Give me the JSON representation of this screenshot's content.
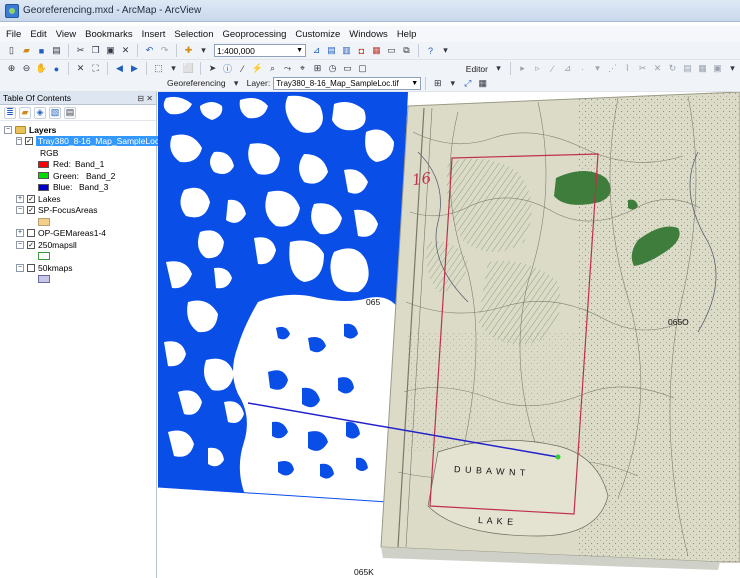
{
  "window": {
    "title": "Georeferencing.mxd - ArcMap - ArcView"
  },
  "menu": [
    "File",
    "Edit",
    "View",
    "Bookmarks",
    "Insert",
    "Selection",
    "Geoprocessing",
    "Customize",
    "Windows",
    "Help"
  ],
  "toolbar": {
    "scale_value": "1:400,000",
    "editor_label": "Editor",
    "georef_label": "Georeferencing",
    "layer_label": "Layer:",
    "layer_value": "Tray380_8-16_Map_SampleLoc.tif"
  },
  "toc": {
    "title": "Table Of Contents",
    "root_label": "Layers",
    "layers": [
      {
        "name": "Tray380_8-16_Map_SampleLoc.tif",
        "checked": true,
        "expanded": true
      },
      {
        "name": "Lakes",
        "checked": true,
        "expanded": false
      },
      {
        "name": "SP-FocusAreas",
        "checked": true,
        "expanded": true
      },
      {
        "name": "OP-GEMareas1-4",
        "checked": false,
        "expanded": false
      },
      {
        "name": "250mapsll",
        "checked": true,
        "expanded": true
      },
      {
        "name": "50kmaps",
        "checked": false,
        "expanded": true
      }
    ],
    "rgb_label": "RGB",
    "bands": [
      {
        "label": "Red:",
        "band": "Band_1",
        "color": "#ff0000"
      },
      {
        "label": "Green:",
        "band": "Band_2",
        "color": "#00dd00"
      },
      {
        "label": "Blue:",
        "band": "Band_3",
        "color": "#0000cc"
      }
    ],
    "symbol_colors": {
      "sp_focus": "#f2cf8a",
      "map250": "#ffffff",
      "map50": "#c8c8e6"
    }
  },
  "map": {
    "labels": {
      "sheet_065": "065",
      "sheet_065o": "065O",
      "sheet_065k": "065K",
      "handwritten": "16",
      "lake_word1": "D U B A W N T",
      "lake_word2": "L A K E"
    },
    "colors": {
      "water": "#0a4ee8",
      "paper": "#dcdbc8",
      "vegetation": "#3e7d3c",
      "red_box": "#c0304a",
      "link_line": "#2222cc"
    }
  }
}
